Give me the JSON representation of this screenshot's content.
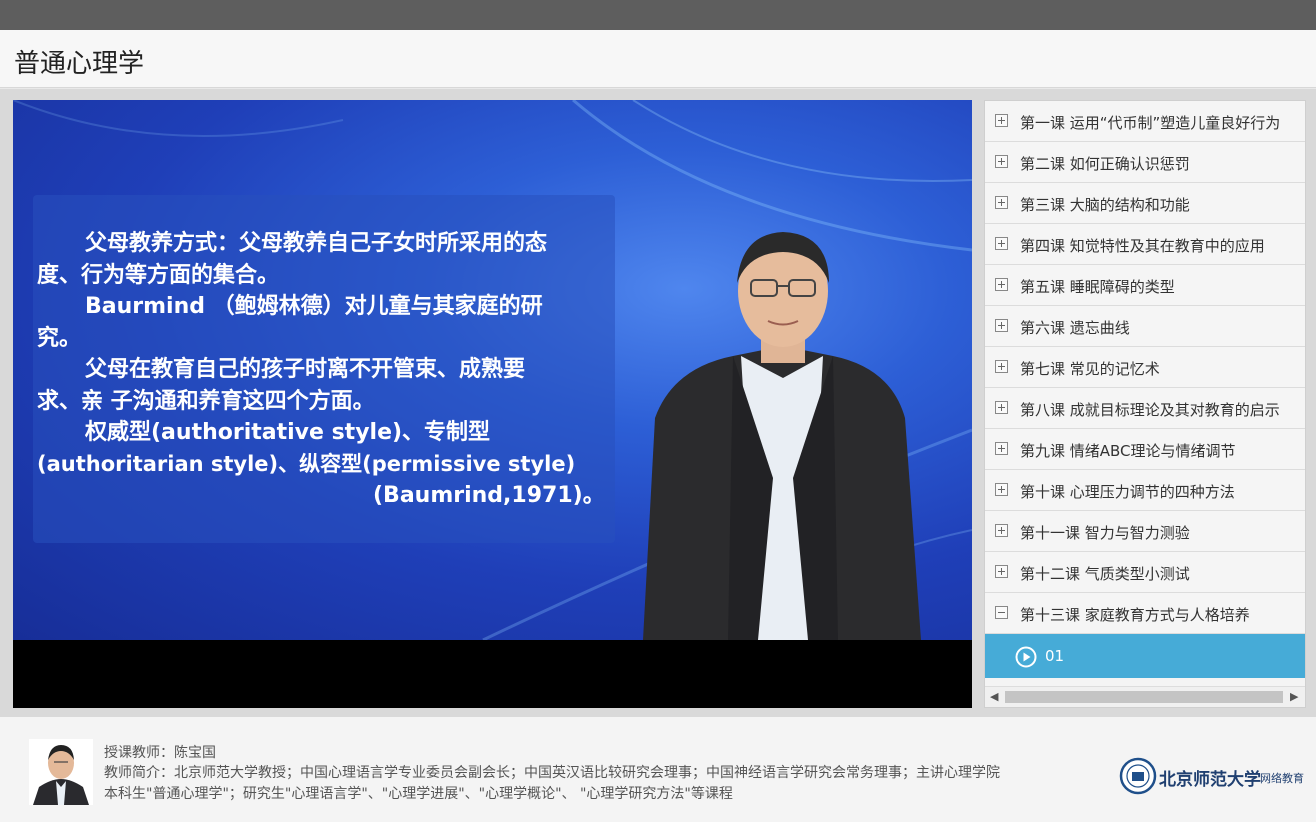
{
  "header": {
    "title": "普通心理学"
  },
  "slide": {
    "lines": [
      "父母教养方式：父母教养自己子女时所采用的态",
      "度、行为等方面的集合。",
      "Baurmind （鲍姆林德）对儿童与其家庭的研",
      "究。",
      "父母在教育自己的孩子时离不开管束、成熟要",
      "求、亲 子沟通和养育这四个方面。",
      "权威型(authoritative style)、专制型",
      "(authoritarian style)、纵容型(permissive style)",
      "(Baumrind,1971)。"
    ]
  },
  "sidebar": {
    "lessons": [
      {
        "label": "第一课 运用“代币制”塑造儿童良好行为"
      },
      {
        "label": "第二课 如何正确认识惩罚"
      },
      {
        "label": "第三课 大脑的结构和功能"
      },
      {
        "label": "第四课 知觉特性及其在教育中的应用"
      },
      {
        "label": "第五课 睡眠障碍的类型"
      },
      {
        "label": "第六课 遗忘曲线"
      },
      {
        "label": "第七课 常见的记忆术"
      },
      {
        "label": "第八课 成就目标理论及其对教育的启示"
      },
      {
        "label": "第九课 情绪ABC理论与情绪调节"
      },
      {
        "label": "第十课 心理压力调节的四种方法"
      },
      {
        "label": "第十一课 智力与智力测验"
      },
      {
        "label": "第十二课 气质类型小测试"
      },
      {
        "label": "第十三课 家庭教育方式与人格培养"
      }
    ],
    "active_sub": {
      "label": "01"
    }
  },
  "footer": {
    "teacher": "授课教师：陈宝国",
    "intro": "教师简介：北京师范大学教授；中国心理语言学专业委员会副会长；中国英汉语比较研究会理事；中国神经语言学研究会常务理事；主讲心理学院本科生\"普通心理学\"；研究生\"心理语言学\"、\"心理学进展\"、\"心理学概论\"、 \"心理学研究方法\"等课程",
    "logo_text": "北京师范大学",
    "logo_sub": "网络教育"
  },
  "colors": {
    "accent": "#46abd7",
    "video_bg": "#1f3fb8"
  },
  "icons": [
    "plus-box-icon",
    "minus-box-icon",
    "play-circle-icon",
    "university-seal-icon"
  ]
}
